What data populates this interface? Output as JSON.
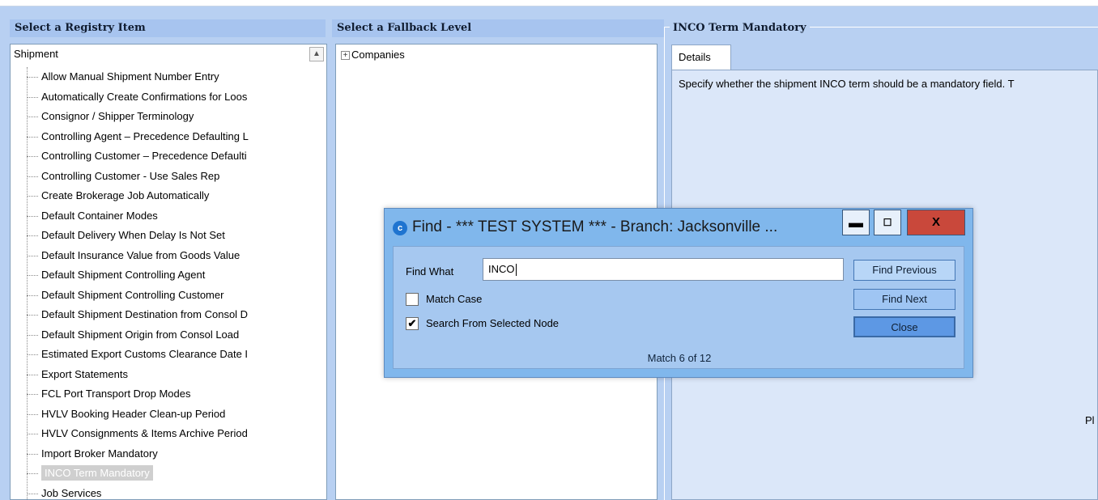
{
  "registry_panel": {
    "title": "Select a Registry Item",
    "root": "Shipment",
    "items": [
      "Allow Manual Shipment Number Entry",
      "Automatically Create Confirmations for Loos",
      "Consignor / Shipper Terminology",
      "Controlling Agent – Precedence Defaulting L",
      "Controlling Customer – Precedence Defaulti",
      "Controlling Customer - Use Sales Rep",
      "Create Brokerage Job Automatically",
      "Default Container Modes",
      "Default Delivery When Delay Is Not Set",
      "Default Insurance Value from Goods Value",
      "Default Shipment Controlling Agent",
      "Default Shipment Controlling Customer",
      "Default Shipment Destination from Consol D",
      "Default Shipment Origin from Consol Load",
      "Estimated Export Customs Clearance Date I",
      "Export Statements",
      "FCL Port Transport Drop Modes",
      "HVLV Booking Header Clean-up Period",
      "HVLV Consignments & Items Archive Period",
      "Import Broker Mandatory",
      "INCO Term Mandatory",
      "Job Services"
    ],
    "selected_index": 20
  },
  "fallback_panel": {
    "title": "Select a Fallback Level",
    "node": "Companies"
  },
  "detail_panel": {
    "title": "INCO Term Mandatory",
    "tab": "Details",
    "description": "Specify whether the shipment INCO term should be a mandatory field. T",
    "cut_text": "Pl"
  },
  "find_dialog": {
    "icon": "app-logo-icon",
    "title": "Find - *** TEST SYSTEM *** - Branch: Jacksonville ...",
    "find_what_label": "Find What",
    "find_what_value": "INCO",
    "match_case_label": "Match Case",
    "match_case_checked": false,
    "search_selected_label": "Search From Selected Node",
    "search_selected_checked": true,
    "find_previous_label": "Find Previous",
    "find_next_label": "Find Next",
    "close_label": "Close",
    "match_status": "Match 6 of 12"
  }
}
